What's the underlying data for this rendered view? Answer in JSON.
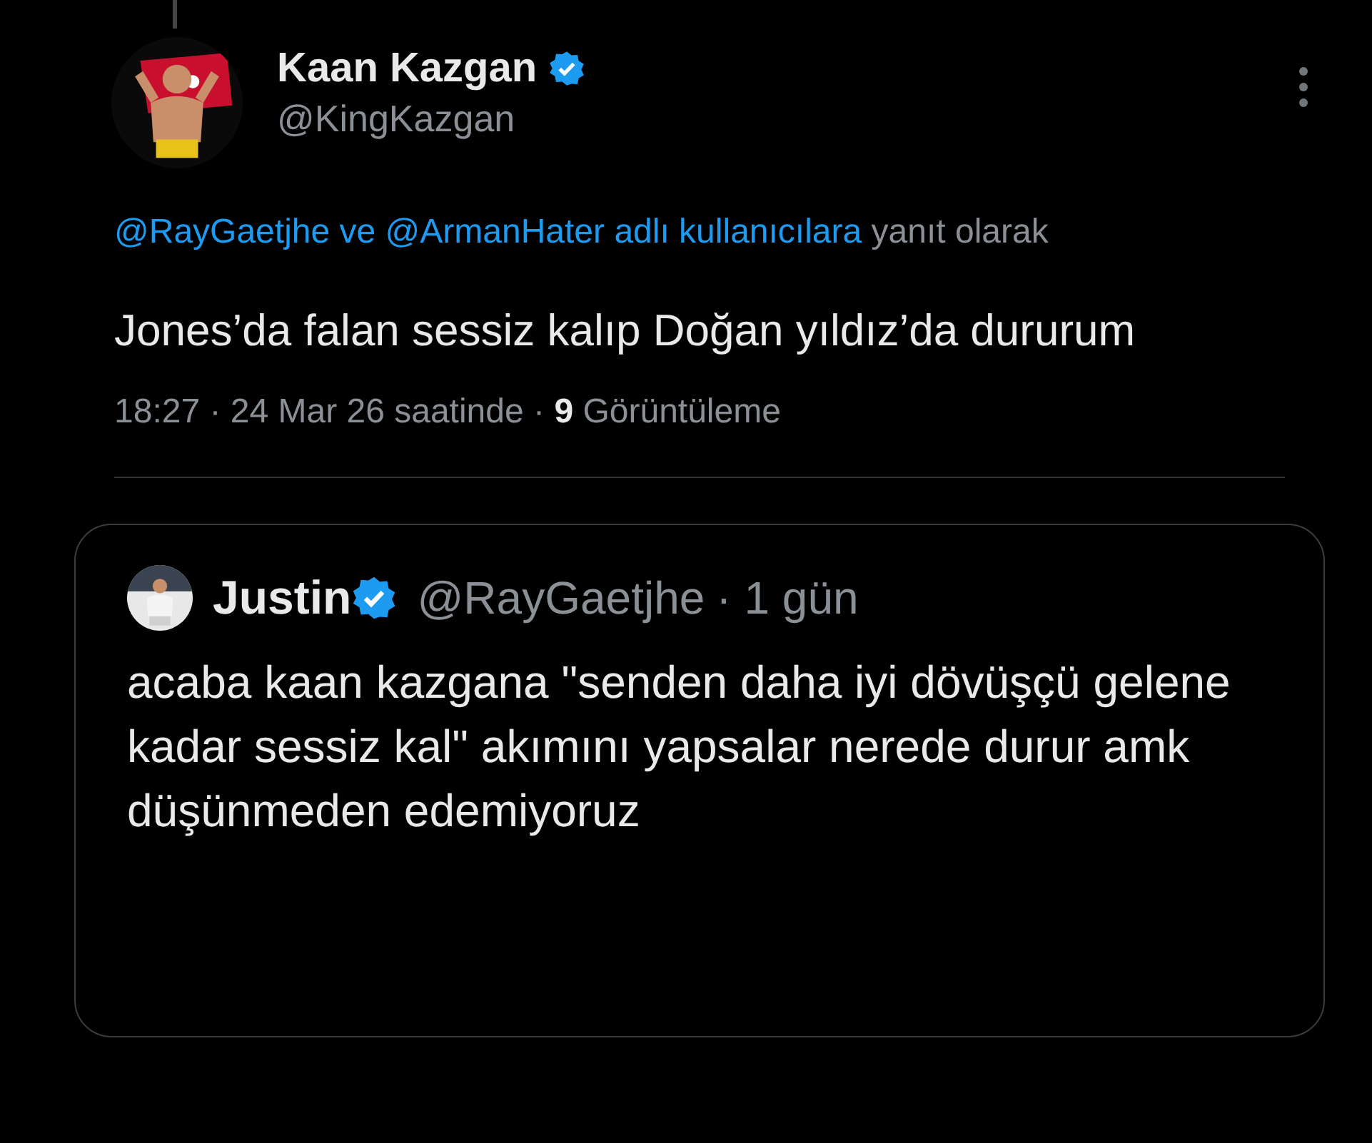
{
  "tweet": {
    "author": {
      "name": "Kaan Kazgan",
      "verified": true,
      "handle": "@KingKazgan"
    },
    "replying_to": {
      "mentions": "@RayGaetjhe ve @ArmanHater adlı kullanıcılara",
      "suffix": "yanıt olarak"
    },
    "text": "Jones’da falan sessiz kalıp Doğan yıldız’da dururum",
    "meta": "18:27 · 24 Mar 26 saatinde · **9** Görüntüleme"
  },
  "quoted_tweet": {
    "author": {
      "name": "Justin",
      "verified": true,
      "handle": "@RayGaetjhe",
      "time": "· 1 gün"
    },
    "text": "acaba kaan kazgana \"senden daha iyi dövüşçü gelene kadar sessiz kal\" akımını yapsalar nerede durur amk düşünmeden edemiyoruz"
  }
}
